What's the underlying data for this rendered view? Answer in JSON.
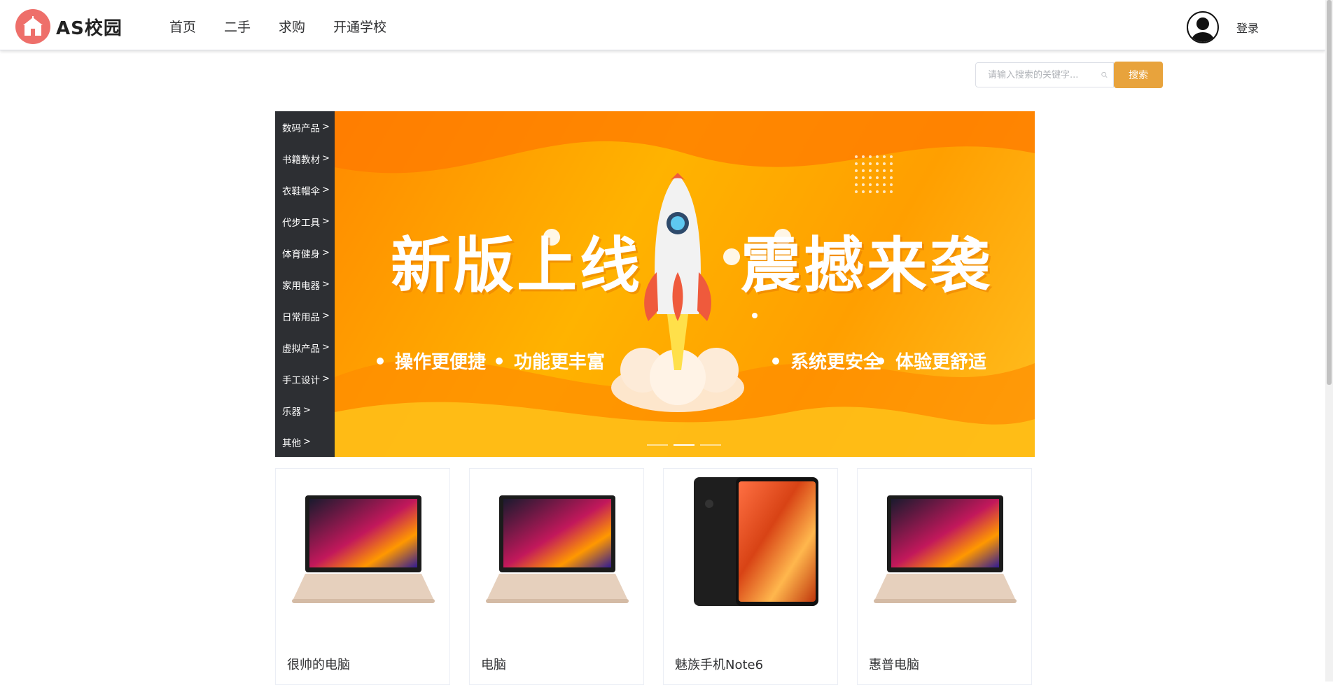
{
  "header": {
    "logo_text": "AS校园",
    "nav": [
      "首页",
      "二手",
      "求购",
      "开通学校"
    ],
    "login_label": "登录"
  },
  "search": {
    "placeholder": "请输入搜索的关键字...",
    "button_label": "搜索"
  },
  "categories": [
    "数码产品",
    "书籍教材",
    "衣鞋帽伞",
    "代步工具",
    "体育健身",
    "家用电器",
    "日常用品",
    "虚拟产品",
    "手工设计",
    "乐器",
    "其他"
  ],
  "banner": {
    "title_left": "新版上线",
    "title_right": "震撼来袭",
    "features": [
      "操作更便捷",
      "功能更丰富",
      "系统更安全",
      "体验更舒适"
    ],
    "slide_count": 3,
    "active_slide": 2
  },
  "products": [
    {
      "name": "很帅的电脑",
      "image": "laptop"
    },
    {
      "name": "电脑",
      "image": "laptop"
    },
    {
      "name": "魅族手机Note6",
      "image": "phone"
    },
    {
      "name": "惠普电脑",
      "image": "laptop"
    }
  ],
  "colors": {
    "accent": "#e8a33c",
    "sidebar_bg": "#2d2f33",
    "logo": "#ee6f6a"
  }
}
